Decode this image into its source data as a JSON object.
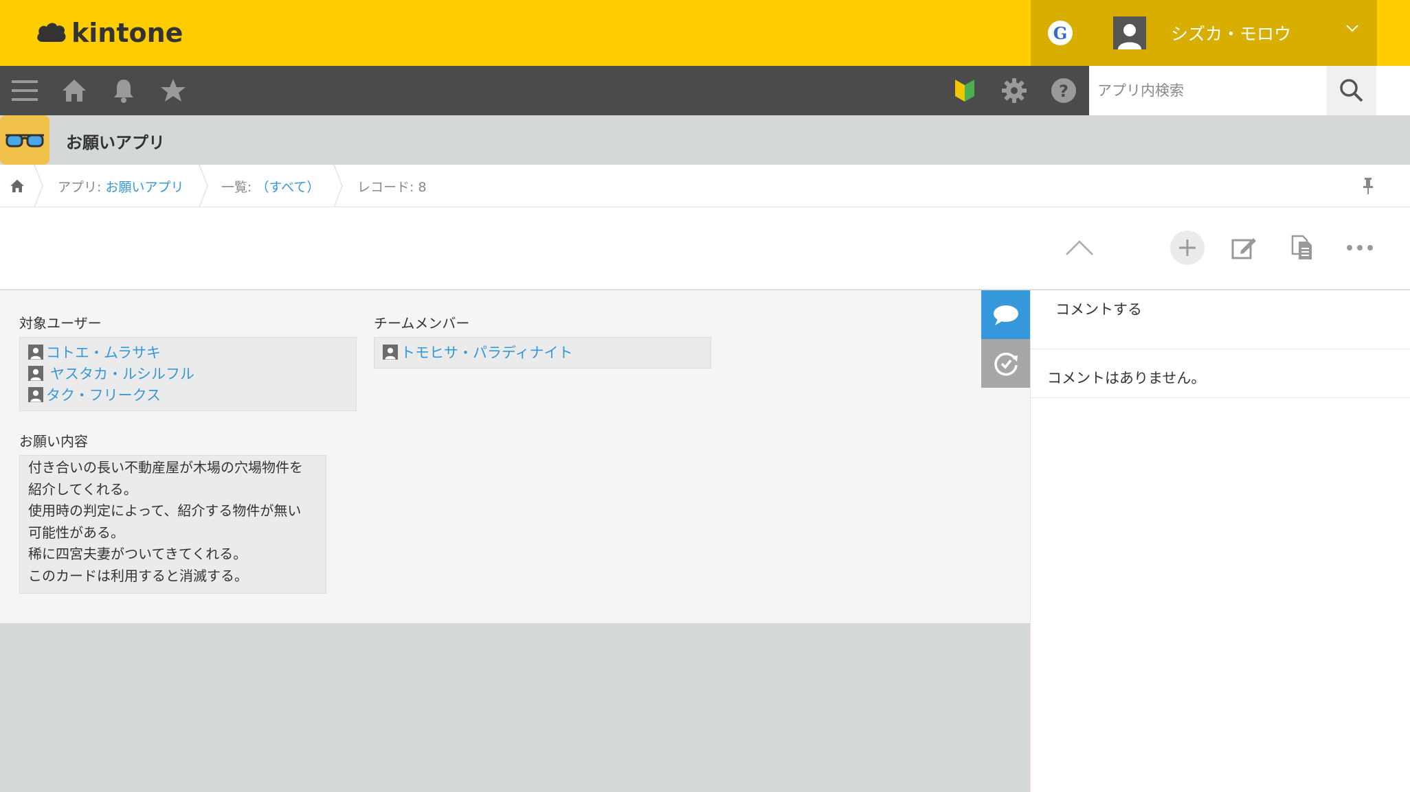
{
  "header": {
    "brand": "kintone",
    "g_label": "G",
    "user_name": "シズカ・モロウ"
  },
  "search": {
    "placeholder": "アプリ内検索"
  },
  "app": {
    "title": "お願いアプリ"
  },
  "breadcrumb": {
    "app_prefix": "アプリ: ",
    "app_name": "お願いアプリ",
    "view_prefix": "一覧: ",
    "view_name": "（すべて）",
    "record": "レコード: 8"
  },
  "record": {
    "target_label": "対象ユーザー",
    "target_users": [
      "コトエ・ムラサキ",
      "ヤスタカ・ルシルフル",
      "タク・フリークス"
    ],
    "team_label": "チームメンバー",
    "team_members": [
      "トモヒサ・パラディナイト"
    ],
    "request_label": "お願い内容",
    "request_lines": [
      "付き合いの長い不動産屋が木場の穴場物件を",
      "紹介してくれる。",
      "使用時の判定によって、紹介する物件が無い",
      "可能性がある。",
      "稀に四宮夫妻がついてきてくれる。",
      "このカードは利用すると消滅する。"
    ]
  },
  "comments": {
    "placeholder": "コメントする",
    "empty": "コメントはありません。"
  },
  "colors": {
    "header_yellow": "#ffcc00",
    "header_dark_yellow": "#d8ae00",
    "nav_dark": "#4b4b4b",
    "link_blue": "#3498db",
    "side_tab_blue": "#3498db"
  }
}
